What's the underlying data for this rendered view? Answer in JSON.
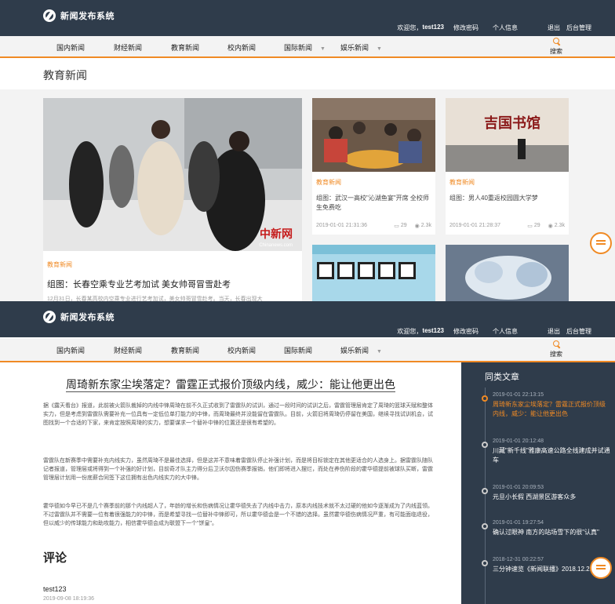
{
  "app": {
    "title": "新闻发布系统"
  },
  "user": {
    "welcome": "欢迎您，",
    "name": "test123",
    "links": [
      "修改密码",
      "个人信息",
      "退出",
      "后台管理"
    ]
  },
  "nav": {
    "items": [
      "国内新闻",
      "财经新闻",
      "教育新闻",
      "校内新闻",
      "国际新闻",
      "娱乐新闻"
    ],
    "search": "搜索"
  },
  "section": {
    "title": "教育新闻"
  },
  "cards": {
    "big": {
      "watermark": "中新网",
      "watermark_sub": "Chinanews.com",
      "tag": "教育新闻",
      "title": "组图：长春空乘专业艺考加试 美女帅哥冒雪赴考",
      "meta": "12月31日，长春某高校内空乘专业进行艺考加试，美女帅哥冒雪赴考。当天，长春出现大"
    },
    "c1": {
      "tag": "教育新闻",
      "title": "组图：武汉一高校\"沁湖鱼宴\"开席 全校师生免费吃",
      "date": "2019-01-01 21:31:36",
      "comments": "29",
      "views": "2.3k"
    },
    "c2": {
      "banner": "吉国书馆",
      "tag": "教育新闻",
      "title": "组图：男人40重返校园圆大学梦",
      "date": "2019-01-01 21:28:37",
      "comments": "29",
      "views": "2.3k"
    }
  },
  "article": {
    "title": "周琦新东家尘埃落定？雷霆正式报价顶级内线，威少：能让他更出色",
    "paragraphs": [
      "据《露天看台》报道，此前被火箭队裁掉的内线中锋周琦在前不久正式收到了雷霆队的试训，通过一段时间的试训之后，雷霆管理层肯定了周琦的篮球天赋和整体实力，但是考虑到雷霆队需要补充一位具有一定低位单打能力的中锋，而周琦最终并没能留在雷霆队。目前，火箭旧将周琦仍停留在美国，继续寻找试训机会，试图找到一个合适的下家，来肯定按照周琦的实力，想要谋求一个替补中锋的位置还是很有希望的。",
      "雷霆队在新赛季中需要补充内线实力，虽然周琦不是最佳选择，但是这并不意味着雷霆队停止补强计划，而是将目标锁定在其他更适合的人选身上。据雷霆队随队记者报道，管理层或将得到一个补强的好计划，目前奇才队主力得分后卫沃尔因伤赛季报销，他们即将进入摆烂，而处在养伤阶段的霍华德提前被球队买断，雷霆管理层计划用一份底薪合同签下这位拥有出色内线实力的大中锋。",
      "霍华德如今早已不是几个赛季前的那个内线超人了，年龄的增长和伤病情况让霍华德失去了内线中击力，原本内线技术就不太过硬的他如今逐渐成为了内线蓝领。不过雷霆队并不需要一位有着很强能力的中锋，而是希望寻找一位替补中锋即可，所以霍华德会是一个不错的选择。虽然霍华德伤病情况严重，有可能面临退役，但以威少的传球能力和助攻能力，相信霍华德会成为联盟下一个\"饼皇\"。"
    ]
  },
  "comments": {
    "heading": "评论",
    "items": [
      {
        "user": "test123",
        "time": "2019-09-08 18:19:36"
      }
    ]
  },
  "sidebar": {
    "heading": "同类文章",
    "items": [
      {
        "date": "2019-01-01 22:13:15",
        "title": "周琦新东家尘埃落定？雷霆正式报价顶级内线，威少：能让他更出色"
      },
      {
        "date": "2019-01-01 20:12:48",
        "title": "川藏\"新千线\"雅康高速公路全线建成并试通车"
      },
      {
        "date": "2019-01-01 20:09:53",
        "title": "元旦小长假 西湖景区游客众多"
      },
      {
        "date": "2019-01-01 19:27:54",
        "title": "确认过眼神 南方的站场雪下的很\"认真\""
      },
      {
        "date": "2018-12-31 00:22:57",
        "title": "三分钟速览《新闻联播》2018.12.29"
      }
    ]
  }
}
